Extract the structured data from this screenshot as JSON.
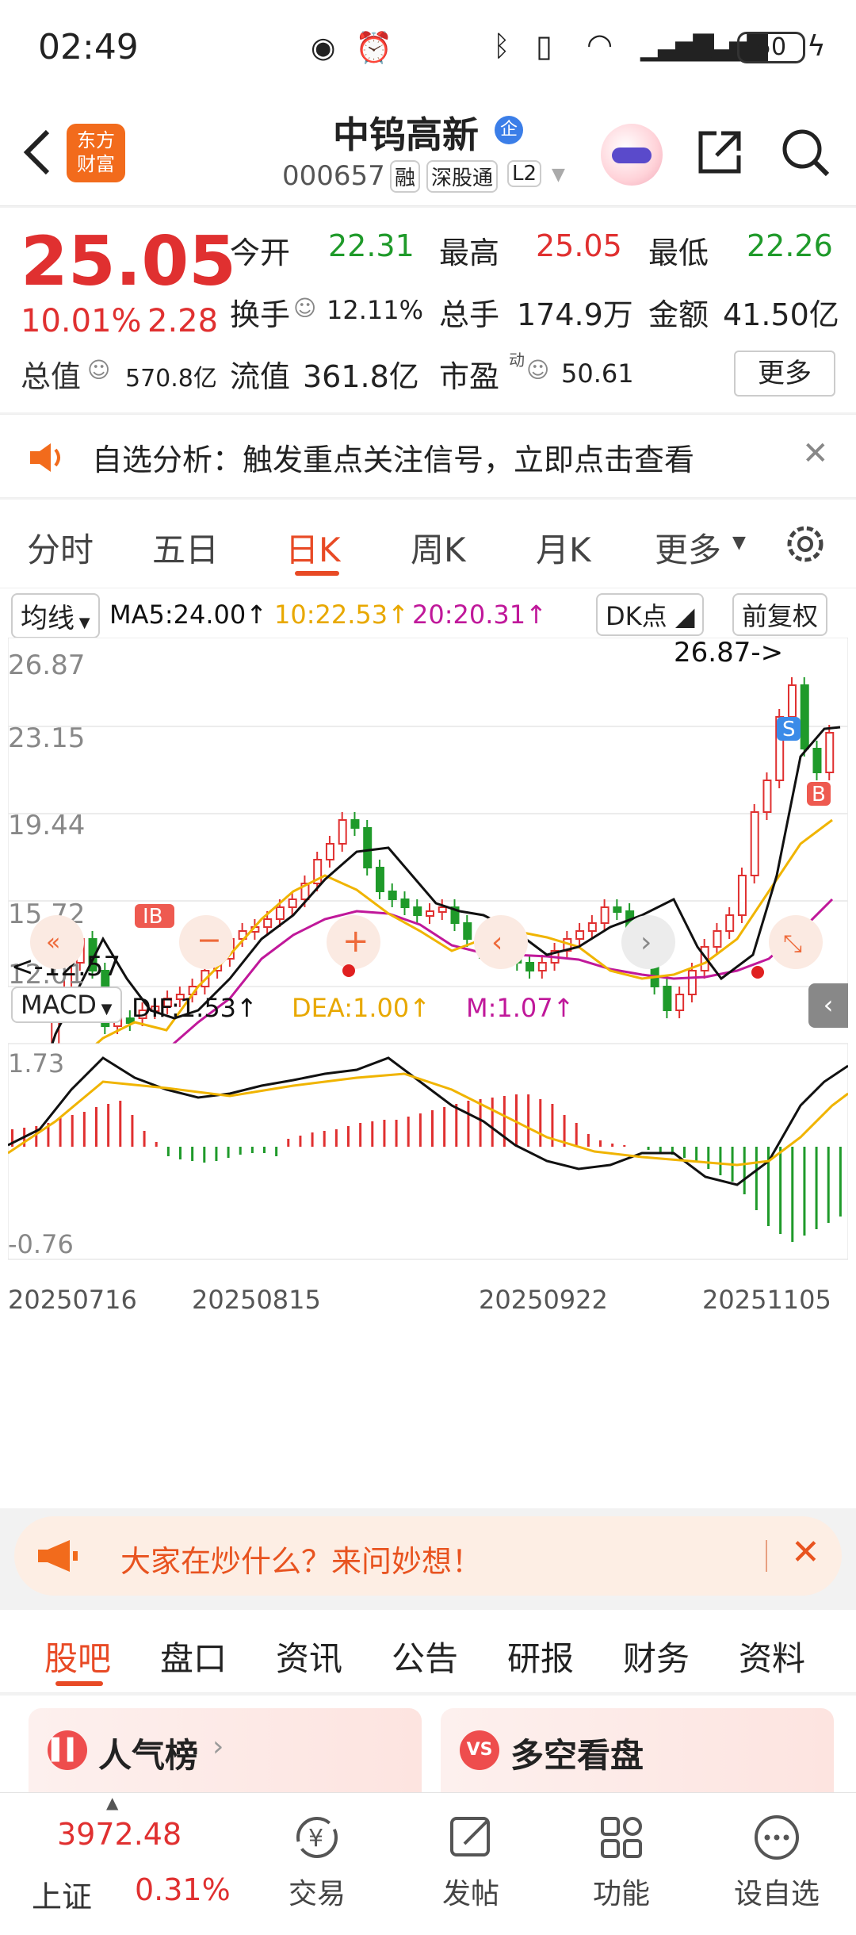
{
  "status": {
    "time": "02:49",
    "battery": "50"
  },
  "header": {
    "title": "中钨高新",
    "code": "000657",
    "tags": [
      "融",
      "深股通",
      "L2"
    ],
    "logo_line1": "东方",
    "logo_line2": "财富",
    "badge": "企"
  },
  "quote": {
    "price": "25.05",
    "pct": "10.01%",
    "change": "2.28",
    "open_label": "今开",
    "open": "22.31",
    "high_label": "最高",
    "high": "25.05",
    "low_label": "最低",
    "low": "22.26",
    "turnover_label": "换手",
    "turnover": "12.11%",
    "vol_label": "总手",
    "vol": "174.9万",
    "amount_label": "金额",
    "amount": "41.50亿",
    "mcap_label": "总值",
    "mcap": "570.8亿",
    "float_label": "流值",
    "float": "361.8亿",
    "pe_label": "市盈",
    "pe_sup": "动",
    "pe": "50.61",
    "more": "更多"
  },
  "notice": {
    "text": "自选分析：触发重点关注信号，立即点击查看"
  },
  "tabs": {
    "items": [
      "分时",
      "五日",
      "日K",
      "周K",
      "月K",
      "更多"
    ],
    "active": 2
  },
  "chart": {
    "ma_label": "均线",
    "ma5": "MA5:24.00↑",
    "ma10": "10:22.53↑",
    "ma20": "20:20.31↑",
    "dk_label": "DK点",
    "adj_label": "前复权",
    "y_ticks": [
      "26.87",
      "23.15",
      "19.44",
      "15.72",
      "12.01"
    ],
    "max_marker": "26.87->",
    "min_marker": "<-12.57",
    "macd_label": "MACD",
    "dif": "DIF:1.53↑",
    "dea": "DEA:1.00↑",
    "m": "M:1.07↑",
    "macd_top": "1.73",
    "macd_bottom": "-0.76",
    "dates": [
      "20250716",
      "20250815",
      "20250922",
      "20251105"
    ],
    "colors": {
      "up": "#e03030",
      "down": "#1f9a2a",
      "ma5": "#111111",
      "ma10": "#f0b400",
      "ma20": "#c0189a"
    }
  },
  "chart_data": {
    "type": "candlestick",
    "title": "",
    "x": [
      "20250716",
      "20250815",
      "20250922",
      "20251105"
    ],
    "close": [
      12.6,
      17.8,
      16.3,
      15.9,
      16.8,
      19.5,
      21.3,
      19.8,
      18.2,
      18.5,
      18.8,
      16.4,
      22.5,
      26.8,
      23.0,
      25.05
    ],
    "ma5_last": 24.0,
    "ma10_last": 22.53,
    "ma20_last": 20.31,
    "ylim": [
      12.01,
      26.87
    ],
    "macd": {
      "dif_last": 1.53,
      "dea_last": 1.0,
      "m_last": 1.07,
      "ylim": [
        -0.76,
        1.73
      ]
    }
  },
  "ask": {
    "text": "大家在炒什么？来问妙想！"
  },
  "bottom_tabs": {
    "items": [
      "股吧",
      "盘口",
      "资讯",
      "公告",
      "研报",
      "财务",
      "资料"
    ],
    "active": 0
  },
  "cards": {
    "hot": "人气榜",
    "vs": "多空看盘",
    "vs_icon": "VS"
  },
  "nav": {
    "index_value": "3972.48",
    "index_name": "上证",
    "index_pct": "0.31%",
    "trade": "交易",
    "post": "发帖",
    "func": "功能",
    "watch": "设自选"
  }
}
